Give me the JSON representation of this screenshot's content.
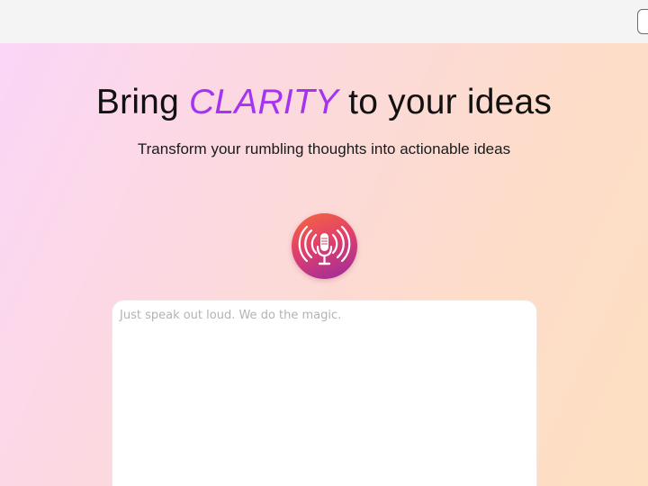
{
  "hero": {
    "headline_start": "Bring ",
    "headline_accent": "CLARITY",
    "headline_end": " to your ideas",
    "subtitle": "Transform your rumbling thoughts into actionable ideas"
  },
  "mic": {
    "icon": "microphone-broadcast-icon"
  },
  "speech_input": {
    "value": "",
    "placeholder": "Just speak out loud. We do the magic."
  },
  "colors": {
    "accent": "#a534f2",
    "mic_gradient_start": "#f26a3d",
    "mic_gradient_end": "#9a2c9e"
  }
}
